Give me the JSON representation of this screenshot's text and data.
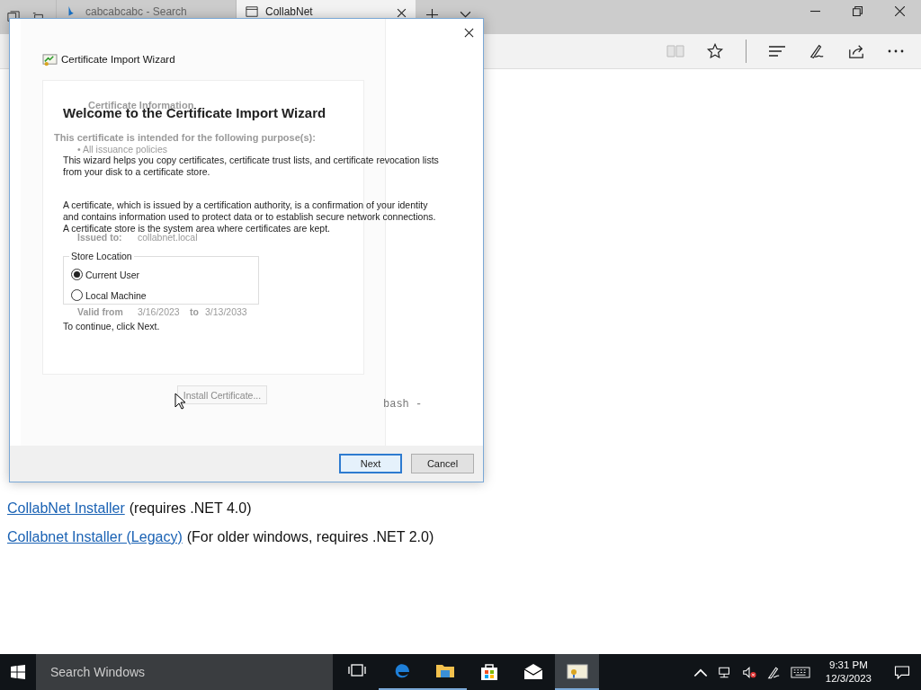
{
  "browser": {
    "tabs": [
      {
        "title": "cabcabcabc - Search",
        "selected": false
      },
      {
        "title": "CollabNet",
        "selected": true
      }
    ],
    "page": {
      "fragment": "bash -",
      "links": [
        {
          "link": "CollabNet Installer",
          "note": "(requires .NET 4.0)"
        },
        {
          "link": "Collabnet Installer (Legacy)",
          "note": "(For older windows, requires .NET 2.0)"
        }
      ]
    }
  },
  "background_dialog": {
    "heading": "Certificate Information",
    "purpose": "This certificate is intended for the following purpose(s):",
    "policies": [
      "• All issuance policies"
    ],
    "issued_to_label": "Issued to:",
    "issued_to": "collabnet.local",
    "valid_from_label": "Valid from",
    "valid_from": "3/16/2023",
    "to_label": "to",
    "valid_to": "3/13/2033",
    "button": "Install Certificate..."
  },
  "wizard": {
    "title": "Certificate Import Wizard",
    "heading": "Welcome to the Certificate Import Wizard",
    "paragraphs": [
      "This wizard helps you copy certificates, certificate trust lists, and certificate revocation lists from your disk to a certificate store.",
      "A certificate, which is issued by a certification authority, is a confirmation of your identity and contains information used to protect data or to establish secure network connections. A certificate store is the system area where certificates are kept."
    ],
    "store_location": {
      "label": "Store Location",
      "options": [
        {
          "label": "Current User",
          "selected": true
        },
        {
          "label": "Local Machine",
          "selected": false
        }
      ]
    },
    "footer_text": "To continue, click Next.",
    "buttons": [
      {
        "label": "Next",
        "default": true
      },
      {
        "label": "Cancel",
        "default": false
      }
    ]
  },
  "taskbar": {
    "search_placeholder": "Search Windows",
    "apps": [
      {
        "kind": "taskview",
        "running": false,
        "active": false
      },
      {
        "kind": "edge",
        "running": true,
        "active": false
      },
      {
        "kind": "explorer",
        "running": true,
        "active": false
      },
      {
        "kind": "store",
        "running": false,
        "active": false
      },
      {
        "kind": "mail",
        "running": false,
        "active": false
      },
      {
        "kind": "certificate",
        "running": true,
        "active": true
      }
    ],
    "clock": {
      "time": "9:31 PM",
      "date": "12/3/2023"
    }
  }
}
